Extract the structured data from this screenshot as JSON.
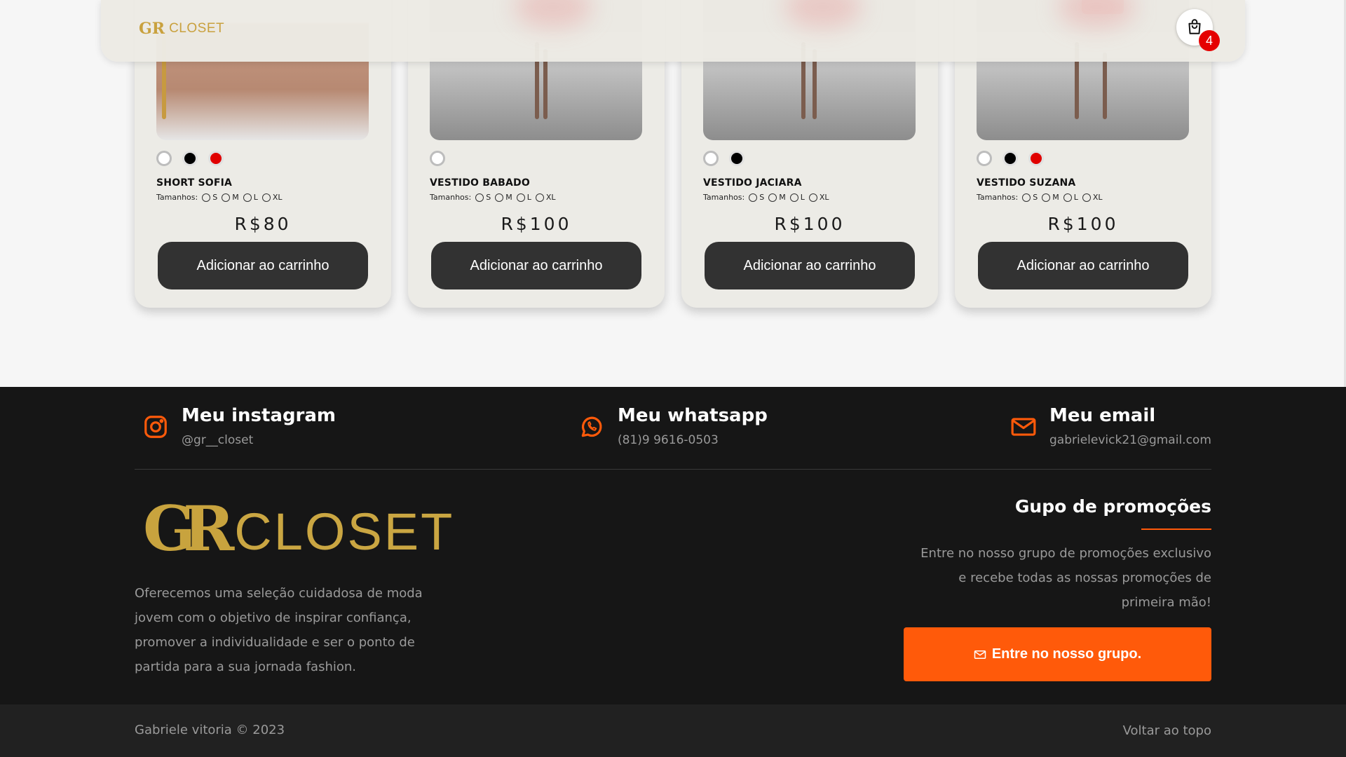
{
  "header": {
    "brand_mono": "GR",
    "brand_name": "CLOSET",
    "cart_count": "4",
    "cart_icon": "shopping-bag-icon"
  },
  "products": [
    {
      "name": "SHORT SOFIA",
      "sizes_label": "Tamanhos:",
      "sizes": [
        "S",
        "M",
        "L",
        "XL"
      ],
      "colors": [
        "white",
        "black",
        "red"
      ],
      "price": "R$80",
      "button": "Adicionar ao carrinho"
    },
    {
      "name": "VESTIDO BABADO",
      "sizes_label": "Tamanhos:",
      "sizes": [
        "S",
        "M",
        "L",
        "XL"
      ],
      "colors": [
        "white"
      ],
      "price": "R$100",
      "button": "Adicionar ao carrinho"
    },
    {
      "name": "VESTIDO JACIARA",
      "sizes_label": "Tamanhos:",
      "sizes": [
        "S",
        "M",
        "L",
        "XL"
      ],
      "colors": [
        "white",
        "black"
      ],
      "price": "R$100",
      "button": "Adicionar ao carrinho"
    },
    {
      "name": "VESTIDO SUZANA",
      "sizes_label": "Tamanhos:",
      "sizes": [
        "S",
        "M",
        "L",
        "XL"
      ],
      "colors": [
        "white",
        "black",
        "red"
      ],
      "price": "R$100",
      "button": "Adicionar ao carrinho"
    }
  ],
  "footer": {
    "contacts": [
      {
        "icon": "instagram-icon",
        "title": "Meu instagram",
        "value": "@gr__closet"
      },
      {
        "icon": "whatsapp-icon",
        "title": "Meu whatsapp",
        "value": "(81)9 9616-0503"
      },
      {
        "icon": "mail-icon",
        "title": "Meu email",
        "value": "gabrielevick21@gmail.com"
      }
    ],
    "logo_mono": "GR",
    "logo_name": "CLOSET",
    "about": "Oferecemos uma seleção cuidadosa de moda jovem com o objetivo de inspirar confiança, promover a individualidade e ser o ponto de partida para a sua jornada fashion.",
    "promo_title": "Gupo de promoções",
    "promo_text": "Entre no nosso grupo de promoções exclusivo e recebe todas as nossas promoções de primeira mão!",
    "promo_button": "Entre no nosso grupo.",
    "copyright": "Gabriele vitoria © 2023",
    "back_to_top": "Voltar ao topo"
  },
  "colors": {
    "accent": "#ff5a0a",
    "gold": "#c9a13e",
    "button_dark": "#323232",
    "badge": "#e50000",
    "footer_bg": "#161616"
  }
}
